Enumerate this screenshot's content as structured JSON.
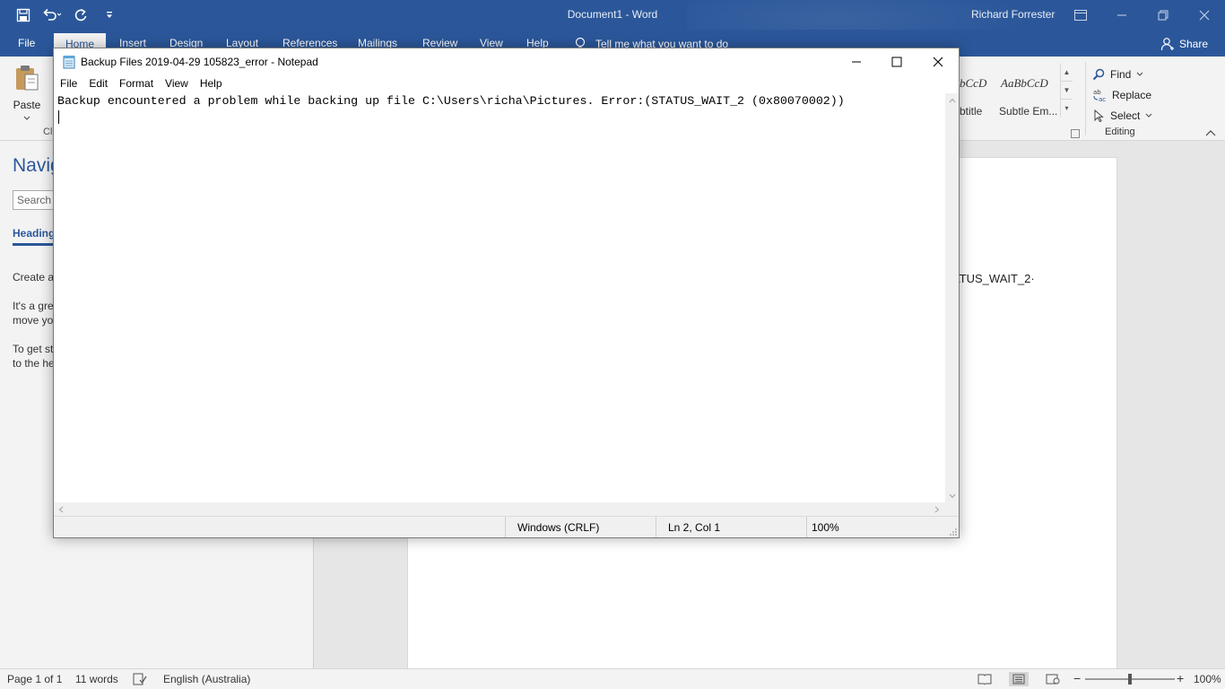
{
  "word": {
    "title": "Document1 - Word",
    "user": "Richard Forrester",
    "tabs": [
      {
        "label": "File"
      },
      {
        "label": "Home"
      },
      {
        "label": "Insert"
      },
      {
        "label": "Design"
      },
      {
        "label": "Layout"
      },
      {
        "label": "References"
      },
      {
        "label": "Mailings"
      },
      {
        "label": "Review"
      },
      {
        "label": "View"
      },
      {
        "label": "Help"
      }
    ],
    "tell_me": "Tell me what you want to do",
    "share": "Share",
    "ribbon": {
      "paste_label": "Paste",
      "clipboard_label": "Cl",
      "styles": [
        {
          "preview": "bCcD",
          "name": "btitle"
        },
        {
          "preview": "AaBbCcD",
          "name": "Subtle Em..."
        }
      ],
      "editing": {
        "find": "Find",
        "replace": "Replace",
        "select": "Select",
        "group_label": "Editing"
      }
    },
    "nav_pane": {
      "title": "Navig",
      "search_placeholder": "Search d",
      "tab": "Heading",
      "text1": "Create ar",
      "text2": "It's a gre",
      "text3": "move yo",
      "text4": "To get st",
      "text5": "to the he"
    },
    "page_text": "TATUS_WAIT_2·",
    "status": {
      "page": "Page 1 of 1",
      "words": "11 words",
      "language": "English (Australia)",
      "zoom": "100%"
    },
    "accent": "#2b579a"
  },
  "notepad": {
    "title": "Backup Files 2019-04-29 105823_error - Notepad",
    "menu": [
      {
        "label": "File"
      },
      {
        "label": "Edit"
      },
      {
        "label": "Format"
      },
      {
        "label": "View"
      },
      {
        "label": "Help"
      }
    ],
    "content": "Backup encountered a problem while backing up file C:\\Users\\richa\\Pictures. Error:(STATUS_WAIT_2 (0x80070002))",
    "status": {
      "line_ending": "Windows (CRLF)",
      "position": "Ln 2, Col 1",
      "zoom": "100%"
    }
  }
}
